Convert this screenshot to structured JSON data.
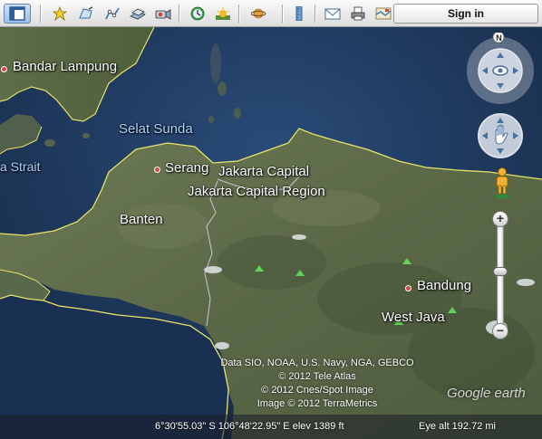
{
  "toolbar": {
    "buttons": [
      "sidebar-toggle",
      "placemark",
      "polygon",
      "path",
      "image-overlay",
      "record-tour",
      "historical-imagery",
      "sunlight",
      "planets",
      "ruler",
      "email",
      "print",
      "view-in-maps"
    ],
    "signin_label": "Sign in"
  },
  "map": {
    "labels": {
      "bandar_lampung": "Bandar Lampung",
      "selat_sunda": "Selat Sunda",
      "strait": "a Strait",
      "serang": "Serang",
      "jakarta_capital": "Jakarta Capital",
      "jakarta_capital_region": "Jakarta Capital Region",
      "banten": "Banten",
      "bandung": "Bandung",
      "west_java": "West Java"
    },
    "attribution": {
      "line1": "Data SIO, NOAA, U.S. Navy, NGA, GEBCO",
      "line2": "© 2012 Tele Atlas",
      "line3": "© 2012 Cnes/Spot Image",
      "line4": "Image © 2012 TerraMetrics"
    },
    "logo": "Google earth"
  },
  "status": {
    "coordinates": "6°30'55.03\" S  106°48'22.95\" E  elev  1389 ft",
    "eye_alt": "Eye alt   192.72 mi"
  },
  "controls": {
    "look_label": "N",
    "zoom_in": "+",
    "zoom_out": "−"
  },
  "colors": {
    "border_line": "#e8e46a",
    "province_line": "#d8d8e8",
    "city_dot": "#d9474a",
    "ocean": "#1c3457",
    "land": "#5d6b4a"
  }
}
